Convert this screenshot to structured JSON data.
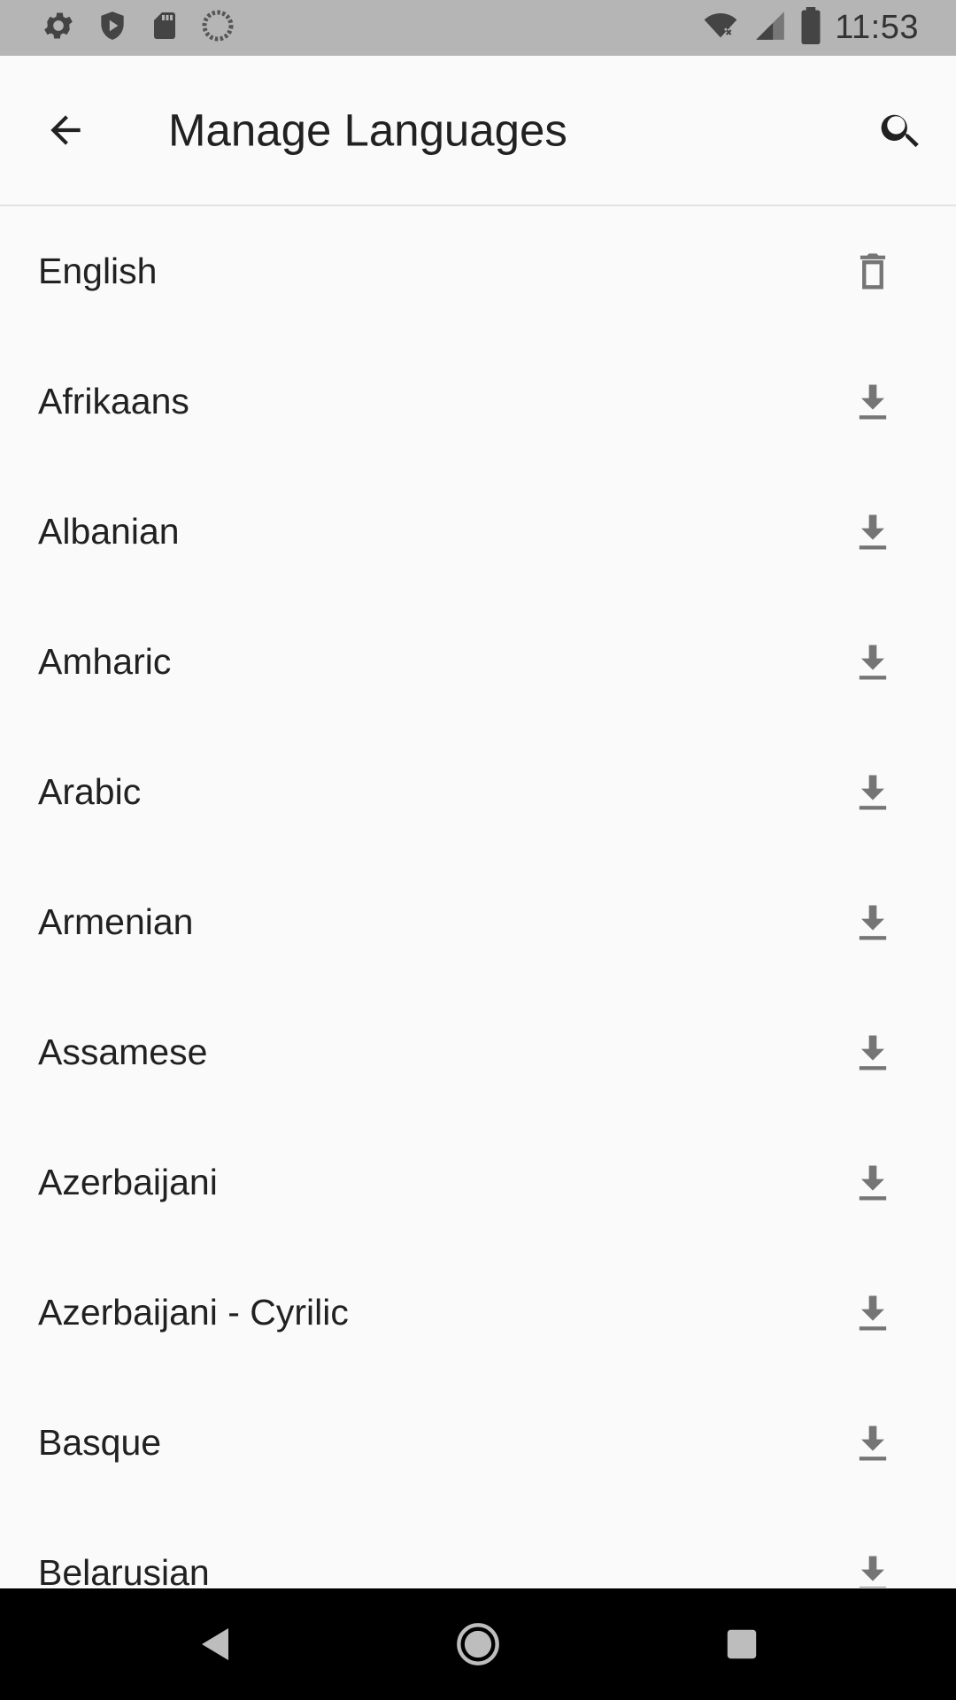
{
  "status_bar": {
    "time": "11:53",
    "left_icons": [
      "gear-icon",
      "shield-icon",
      "sd-card-icon",
      "sync-circle-icon"
    ],
    "right_icons": [
      "wifi-off-icon",
      "cell-signal-icon",
      "battery-icon"
    ]
  },
  "app_bar": {
    "title": "Manage Languages",
    "back_icon": "arrow-back-icon",
    "search_icon": "search-icon"
  },
  "languages": [
    {
      "label": "English",
      "action": "delete"
    },
    {
      "label": "Afrikaans",
      "action": "download"
    },
    {
      "label": "Albanian",
      "action": "download"
    },
    {
      "label": "Amharic",
      "action": "download"
    },
    {
      "label": "Arabic",
      "action": "download"
    },
    {
      "label": "Armenian",
      "action": "download"
    },
    {
      "label": "Assamese",
      "action": "download"
    },
    {
      "label": "Azerbaijani",
      "action": "download"
    },
    {
      "label": "Azerbaijani - Cyrilic",
      "action": "download"
    },
    {
      "label": "Basque",
      "action": "download"
    },
    {
      "label": "Belarusian",
      "action": "download"
    }
  ],
  "nav_bar": {
    "icons": [
      "nav-back-icon",
      "nav-home-icon",
      "nav-recents-icon"
    ]
  },
  "colors": {
    "status_bar_bg": "#b5b5b5",
    "background": "#fafafa",
    "text": "#212121",
    "icon": "#757575",
    "nav_bar_bg": "#000000"
  }
}
